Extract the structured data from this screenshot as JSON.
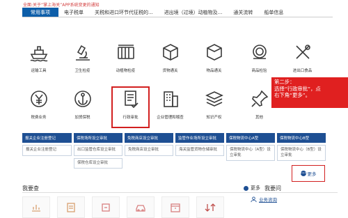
{
  "notice": "全面:关于“掌上海关”APP系统变更的通知",
  "tabs": [
    "常用事项",
    "电子税单",
    "关税和进口环节代征税的...",
    "进出境（过境）动植物及...",
    "通关流转",
    "船单信息"
  ],
  "tiles_row1": [
    "运输工具",
    "卫生检疫",
    "动植物检疫",
    "货物通关",
    "物品通关",
    "商品检验",
    "进出口食品"
  ],
  "tiles_row2": [
    "税费业务",
    "加贸保税",
    "行政审批",
    "企业管理和稽查",
    "知识产权",
    "其他"
  ],
  "callout": {
    "line1": "第二步：",
    "line2": "选择“行政审批”，点",
    "line3": "右下角“更多”。"
  },
  "headers": [
    "报关企业注册登记",
    "保税场所设立审批",
    "免税商店设立审批",
    "监管作业场所设立审批",
    "保税物流中心A型",
    "保税物流中心B型"
  ],
  "cells": [
    [
      "报关企业注册登记"
    ],
    [
      "出口监管仓库设立审批",
      "保税仓库设立审批"
    ],
    [
      "免税商店设立审批"
    ],
    [
      "海关监管货物仓储审批"
    ],
    [
      "保税物流中心（A型）设立审批"
    ],
    [
      "保税物流中心（B型）设立审批"
    ]
  ],
  "more": "更多",
  "section": {
    "title": "我要查",
    "more": "更多",
    "ask": "我要问"
  },
  "biz_consult": "业务咨询",
  "colors": {
    "primary": "#1e4f93",
    "highlight": "#d21f1f"
  }
}
